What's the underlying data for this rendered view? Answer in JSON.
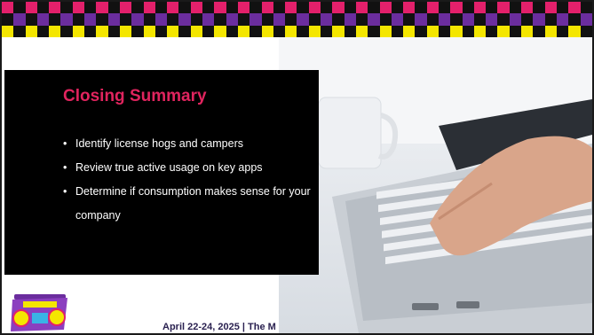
{
  "slide": {
    "title": "Closing Summary",
    "bullets": [
      "Identify license hogs and campers",
      "Review true active usage on key apps",
      "Determine if consumption makes sense for your company"
    ],
    "footer_text": "April 22-24, 2025 | The M"
  },
  "colors": {
    "title": "#e0245e",
    "checker_pink": "#e3206b",
    "checker_purple": "#6b2d9e",
    "checker_yellow": "#f4e600",
    "checker_dark": "#111111"
  },
  "icons": {
    "logo": "boombox-icon",
    "photo": "laptop-typing-photo"
  }
}
